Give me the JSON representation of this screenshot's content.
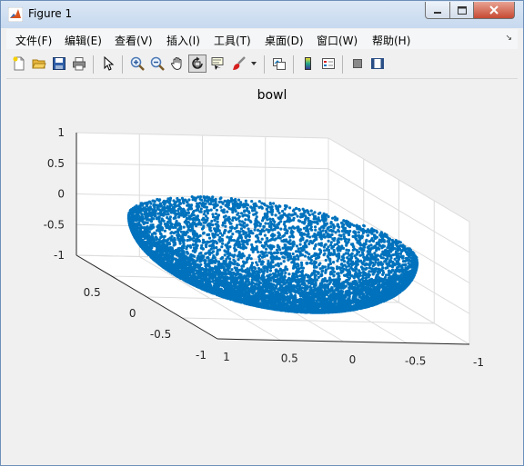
{
  "window": {
    "title": "Figure 1"
  },
  "menu": [
    "文件(F)",
    "编辑(E)",
    "查看(V)",
    "插入(I)",
    "工具(T)",
    "桌面(D)",
    "窗口(W)",
    "帮助(H)"
  ],
  "toolbar": [
    "new-figure-icon",
    "open-file-icon",
    "save-icon",
    "print-icon",
    "select-arrow-icon",
    "zoom-in-icon",
    "zoom-out-icon",
    "pan-hand-icon",
    "rotate-3d-icon",
    "data-cursor-icon",
    "brush-icon",
    "brush-dropdown-icon",
    "link-plot-icon",
    "colorbar-icon",
    "legend-icon",
    "hide-plot-tools-icon",
    "show-plot-tools-icon"
  ],
  "colors": {
    "points": "#0072bd",
    "grid": "#dcdcdc",
    "axes": "#262626",
    "face": "#ffffff"
  },
  "chart_data": {
    "type": "scatter",
    "dimensions": 3,
    "title": "bowl",
    "xlabel": "",
    "ylabel": "",
    "zlabel": "",
    "x_ticks": [
      "1",
      "0.5",
      "0",
      "-0.5",
      "-1"
    ],
    "y_ticks": [
      "0.5",
      "0",
      "-0.5",
      "-1"
    ],
    "z_ticks": [
      "1",
      "0.5",
      "0",
      "-0.5",
      "-1"
    ],
    "xlim": [
      -1,
      1
    ],
    "ylim": [
      -1,
      1
    ],
    "zlim": [
      -1,
      1
    ],
    "grid": true,
    "box": true,
    "marker": "point",
    "series_color": "#0072bd",
    "shape": "points on a hemispherical bowl surface z = -sqrt(1 - x^2 - y^2), radius 1",
    "n_points": 10000
  }
}
